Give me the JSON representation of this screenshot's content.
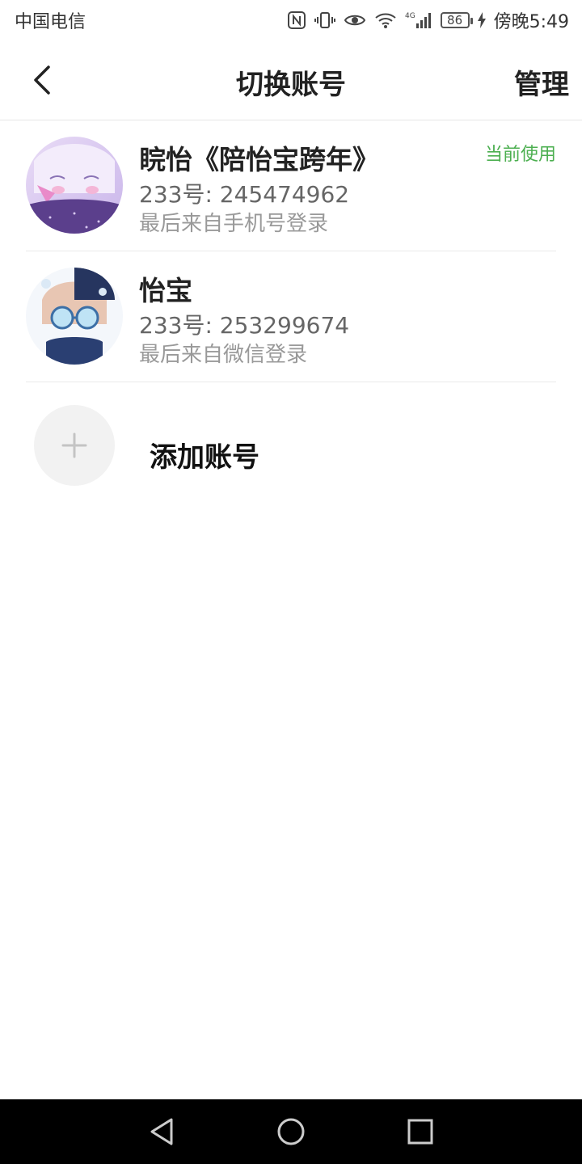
{
  "status_bar": {
    "carrier": "中国电信",
    "network": "4G",
    "battery": "86",
    "time": "傍晚5:49"
  },
  "header": {
    "title": "切换账号",
    "manage_label": "管理",
    "back_icon": "chevron-left-icon"
  },
  "accounts": [
    {
      "name": "睆怡《陪怡宝跨年》",
      "id_text": "233号: 245474962",
      "login_text": "最后来自手机号登录",
      "badge": "当前使用"
    },
    {
      "name": "怡宝",
      "id_text": "233号: 253299674",
      "login_text": "最后来自微信登录",
      "badge": ""
    }
  ],
  "add_account": {
    "label": "添加账号",
    "icon": "plus-icon"
  },
  "colors": {
    "current_badge": "#4caf50",
    "divider": "#e9e9e9",
    "nav_bar": "#000000"
  }
}
